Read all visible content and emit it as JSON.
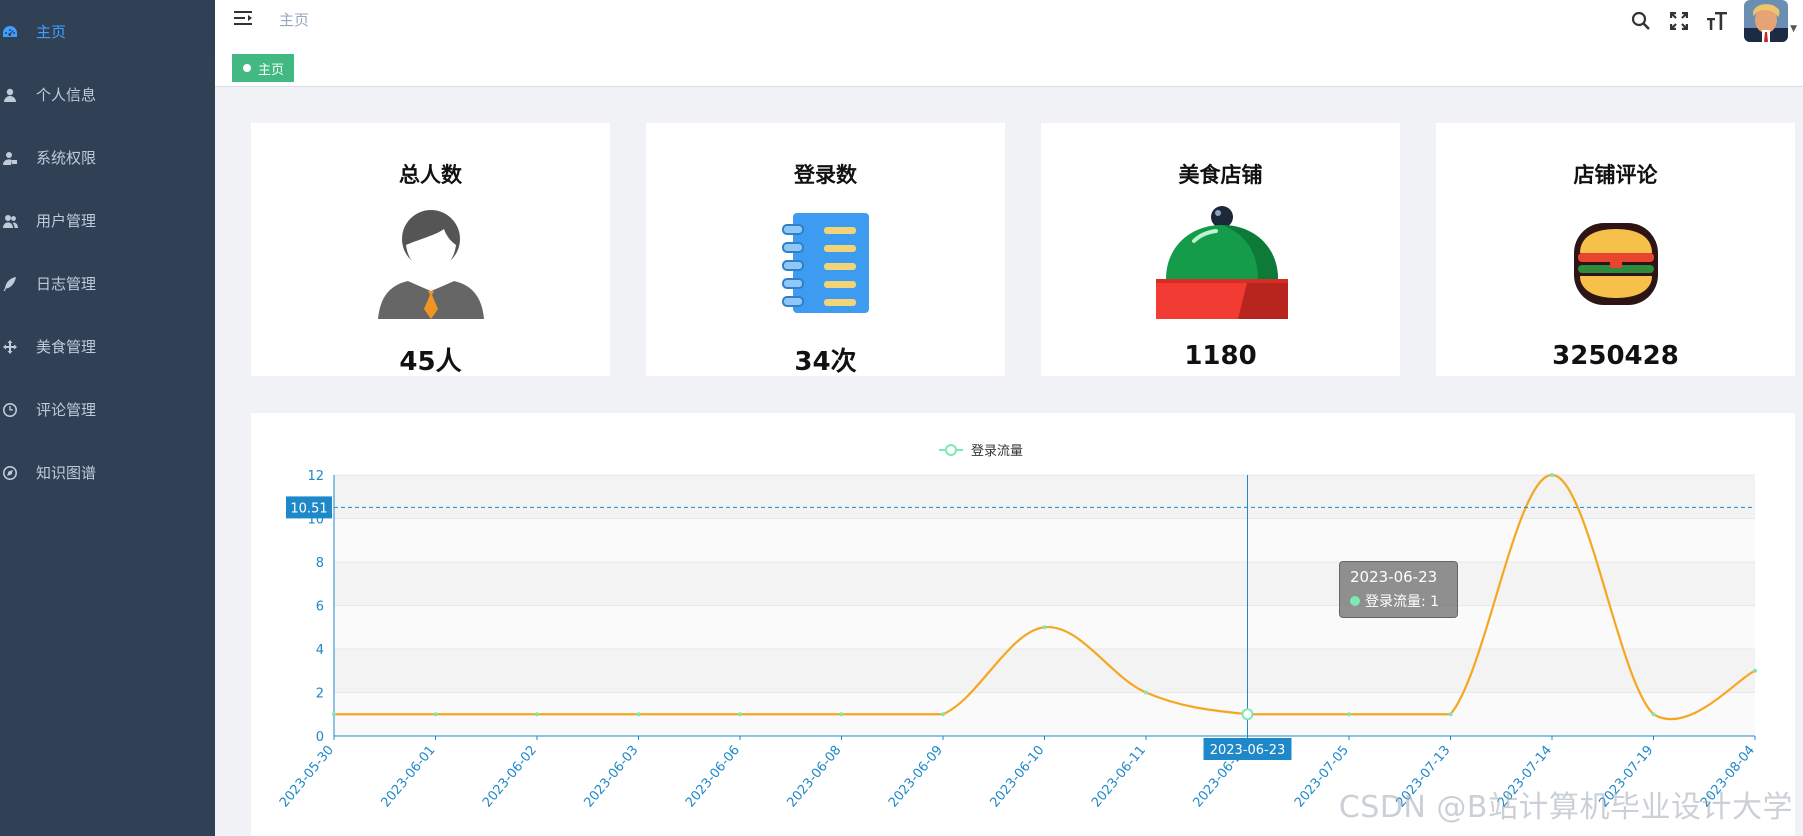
{
  "sidebar": {
    "items": [
      {
        "label": "主页",
        "icon": "dashboard-icon",
        "active": true
      },
      {
        "label": "个人信息",
        "icon": "user-icon"
      },
      {
        "label": "系统权限",
        "icon": "permission-icon"
      },
      {
        "label": "用户管理",
        "icon": "peoples-icon"
      },
      {
        "label": "日志管理",
        "icon": "feather-icon"
      },
      {
        "label": "美食管理",
        "icon": "move-icon"
      },
      {
        "label": "评论管理",
        "icon": "clock-icon"
      },
      {
        "label": "知识图谱",
        "icon": "guide-icon"
      }
    ]
  },
  "header": {
    "breadcrumb": "主页",
    "icons": [
      "search-icon",
      "fullscreen-icon",
      "font-size-icon"
    ],
    "avatar": "user-avatar"
  },
  "tags": {
    "active": "主页"
  },
  "cards": [
    {
      "title": "总人数",
      "value": "45人",
      "icon": "businessman-icon"
    },
    {
      "title": "登录数",
      "value": "34次",
      "icon": "notebook-icon"
    },
    {
      "title": "美食店铺",
      "value": "1180",
      "icon": "food-cloche-icon"
    },
    {
      "title": "店铺评论",
      "value": "3250428",
      "icon": "hamburger-icon"
    }
  ],
  "chart_data": {
    "type": "line",
    "legend": [
      "登录流量"
    ],
    "x": [
      "2023-05-30",
      "2023-06-01",
      "2023-06-02",
      "2023-06-03",
      "2023-06-06",
      "2023-06-08",
      "2023-06-09",
      "2023-06-10",
      "2023-06-11",
      "2023-06-23",
      "2023-07-05",
      "2023-07-13",
      "2023-07-14",
      "2023-07-19",
      "2023-08-04"
    ],
    "series": [
      {
        "name": "登录流量",
        "values": [
          1,
          1,
          1,
          1,
          1,
          1,
          1,
          5,
          2,
          1,
          1,
          1,
          12,
          1,
          3
        ]
      }
    ],
    "y_ticks": [
      0,
      2,
      4,
      6,
      8,
      10,
      12
    ],
    "ylim": [
      0,
      12
    ],
    "grid": true,
    "line_color": "#f5a623",
    "point_color": "#7ee8b4",
    "axis_color": "#1e88c8",
    "crosshair": {
      "x_label": "2023-06-23",
      "y_label": "10.51",
      "y_value": 10.51
    },
    "tooltip": {
      "title": "2023-06-23",
      "row": "登录流量: 1"
    }
  },
  "watermark": "CSDN @B站计算机毕业设计大学"
}
